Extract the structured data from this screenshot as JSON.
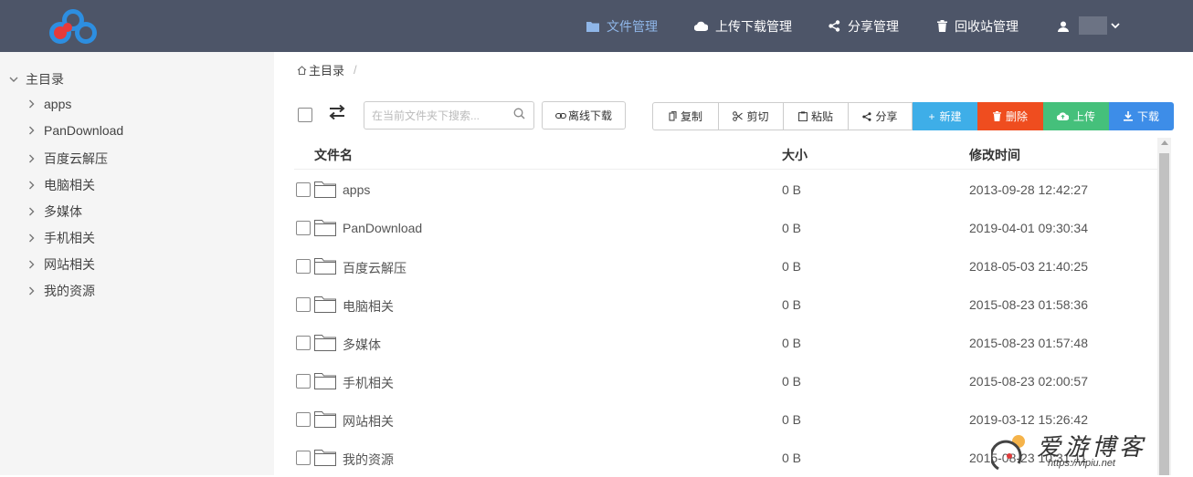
{
  "nav": {
    "items": [
      {
        "icon": "folder-icon",
        "label": "文件管理",
        "active": true
      },
      {
        "icon": "cloud-icon",
        "label": "上传下载管理",
        "active": false
      },
      {
        "icon": "share-icon",
        "label": "分享管理",
        "active": false
      },
      {
        "icon": "trash-icon",
        "label": "回收站管理",
        "active": false
      }
    ],
    "user_icon": "user-icon",
    "user_caret": "chevron-down-icon"
  },
  "sidebar": {
    "root": "主目录",
    "items": [
      "apps",
      "PanDownload",
      "百度云解压",
      "电脑相关",
      "多媒体",
      "手机相关",
      "网站相关",
      "我的资源"
    ]
  },
  "breadcrumb": {
    "home": "主目录",
    "sep": "/"
  },
  "toolbar": {
    "search_placeholder": "在当前文件夹下搜索...",
    "offline_label": "离线下载",
    "copy_label": "复制",
    "cut_label": "剪切",
    "paste_label": "粘贴",
    "share_label": "分享",
    "new_label": "新建",
    "delete_label": "删除",
    "upload_label": "上传",
    "download_label": "下载"
  },
  "colors": {
    "topbar": "#4d5568",
    "nav_active": "#8fb6e8",
    "new_btn": "#3eaee8",
    "delete_btn": "#ef4d1f",
    "upload_btn": "#45c07b",
    "download_btn": "#3d8de8"
  },
  "table": {
    "headers": {
      "name": "文件名",
      "size": "大小",
      "time": "修改时间"
    },
    "rows": [
      {
        "name": "apps",
        "size": "0 B",
        "time": "2013-09-28 12:42:27"
      },
      {
        "name": "PanDownload",
        "size": "0 B",
        "time": "2019-04-01 09:30:34"
      },
      {
        "name": "百度云解压",
        "size": "0 B",
        "time": "2018-05-03 21:40:25"
      },
      {
        "name": "电脑相关",
        "size": "0 B",
        "time": "2015-08-23 01:58:36"
      },
      {
        "name": "多媒体",
        "size": "0 B",
        "time": "2015-08-23 01:57:48"
      },
      {
        "name": "手机相关",
        "size": "0 B",
        "time": "2015-08-23 02:00:57"
      },
      {
        "name": "网站相关",
        "size": "0 B",
        "time": "2019-03-12 15:26:42"
      },
      {
        "name": "我的资源",
        "size": "0 B",
        "time": "2015-08-23 10:31:11"
      }
    ]
  },
  "watermark": {
    "text": "爱游博客",
    "url": "https://vipiu.net"
  }
}
